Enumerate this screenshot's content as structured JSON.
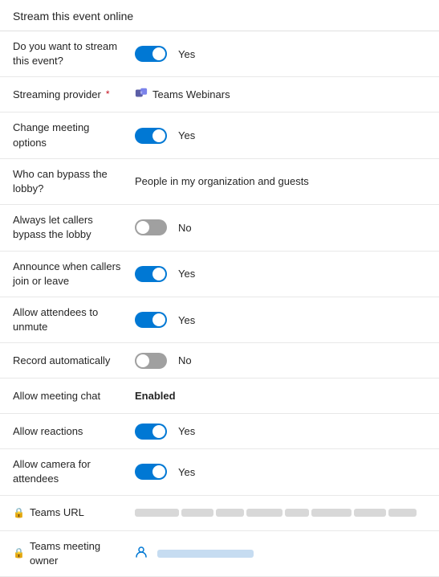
{
  "page": {
    "title": "Stream this event online"
  },
  "rows": [
    {
      "id": "stream-event",
      "label": "Do you want to stream this event?",
      "type": "toggle",
      "toggleState": "on",
      "valueLabel": "Yes"
    },
    {
      "id": "streaming-provider",
      "label": "Streaming provider",
      "required": true,
      "type": "provider",
      "valueLabel": "Teams Webinars"
    },
    {
      "id": "change-meeting-options",
      "label": "Change meeting options",
      "type": "toggle",
      "toggleState": "on",
      "valueLabel": "Yes"
    },
    {
      "id": "bypass-lobby",
      "label": "Who can bypass the lobby?",
      "type": "text",
      "valueLabel": "People in my organization and guests"
    },
    {
      "id": "callers-bypass-lobby",
      "label": "Always let callers bypass the lobby",
      "type": "toggle",
      "toggleState": "off",
      "valueLabel": "No"
    },
    {
      "id": "announce-callers",
      "label": "Announce when callers join or leave",
      "type": "toggle",
      "toggleState": "on",
      "valueLabel": "Yes"
    },
    {
      "id": "allow-unmute",
      "label": "Allow attendees to unmute",
      "type": "toggle",
      "toggleState": "on",
      "valueLabel": "Yes"
    },
    {
      "id": "record-automatically",
      "label": "Record automatically",
      "type": "toggle",
      "toggleState": "off",
      "valueLabel": "No"
    },
    {
      "id": "allow-meeting-chat",
      "label": "Allow meeting chat",
      "type": "text",
      "valueLabel": "Enabled",
      "bold": true
    },
    {
      "id": "allow-reactions",
      "label": "Allow reactions",
      "type": "toggle",
      "toggleState": "on",
      "valueLabel": "Yes"
    },
    {
      "id": "allow-camera",
      "label": "Allow camera for attendees",
      "type": "toggle",
      "toggleState": "on",
      "valueLabel": "Yes"
    },
    {
      "id": "teams-url",
      "label": "Teams URL",
      "type": "url",
      "hasLock": true
    },
    {
      "id": "teams-owner",
      "label": "Teams meeting owner",
      "type": "owner",
      "hasLock": true
    }
  ],
  "icons": {
    "lock": "🔒",
    "person": "👤"
  }
}
